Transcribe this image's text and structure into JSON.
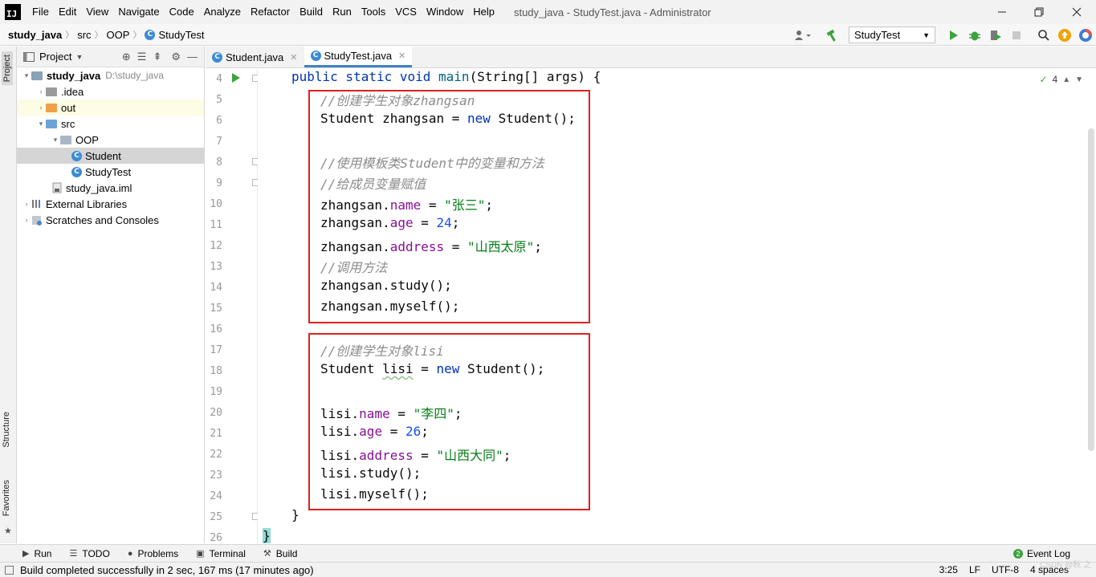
{
  "app": {
    "logo": "IJ",
    "menu": [
      "File",
      "Edit",
      "View",
      "Navigate",
      "Code",
      "Analyze",
      "Refactor",
      "Build",
      "Run",
      "Tools",
      "VCS",
      "Window",
      "Help"
    ],
    "window_title": "study_java - StudyTest.java - Administrator"
  },
  "breadcrumb": [
    "study_java",
    "src",
    "OOP",
    "StudyTest"
  ],
  "toolbar": {
    "run_config": "StudyTest"
  },
  "side_tabs": {
    "project": "Project",
    "structure": "Structure",
    "favorites": "Favorites"
  },
  "project": {
    "header": "Project",
    "tree": [
      {
        "label": "study_java",
        "extra": "D:\\study_java",
        "arrow": "▾",
        "type": "project"
      },
      {
        "label": ".idea",
        "arrow": "›",
        "type": "folder-grey"
      },
      {
        "label": "out",
        "arrow": "›",
        "type": "folder-orange"
      },
      {
        "label": "src",
        "arrow": "▾",
        "type": "folder-blue"
      },
      {
        "label": "OOP",
        "arrow": "▾",
        "type": "package"
      },
      {
        "label": "Student",
        "arrow": "",
        "type": "class"
      },
      {
        "label": "StudyTest",
        "arrow": "",
        "type": "class"
      },
      {
        "label": "study_java.iml",
        "arrow": "",
        "type": "file"
      },
      {
        "label": "External Libraries",
        "arrow": "›",
        "type": "lib"
      },
      {
        "label": "Scratches and Consoles",
        "arrow": "›",
        "type": "scratch"
      }
    ]
  },
  "editor": {
    "tabs": [
      {
        "label": "Student.java",
        "active": false
      },
      {
        "label": "StudyTest.java",
        "active": true
      }
    ],
    "line_numbers": [
      "4",
      "5",
      "6",
      "7",
      "8",
      "9",
      "10",
      "11",
      "12",
      "13",
      "14",
      "15",
      "16",
      "17",
      "18",
      "19",
      "20",
      "21",
      "22",
      "23",
      "24",
      "25",
      "26"
    ],
    "inspection_count": "4"
  },
  "code": {
    "main_sig": {
      "kw": "public static void",
      "name": "main",
      "params": "(String[] args) {"
    },
    "l5": "//创建学生对象zhangsan",
    "l6": {
      "a": "Student zhangsan = ",
      "kw": "new",
      "b": " Student();"
    },
    "l8": "//使用模板类Student中的变量和方法",
    "l9": "//给成员变量赋值",
    "l10": {
      "obj": "zhangsan.",
      "field": "name",
      "eq": " = ",
      "val": "\"张三\"",
      "end": ";"
    },
    "l11": {
      "obj": "zhangsan.",
      "field": "age",
      "eq": " = ",
      "val": "24",
      "end": ";"
    },
    "l12": {
      "obj": "zhangsan.",
      "field": "address",
      "eq": " = ",
      "val": "\"山西太原\"",
      "end": ";"
    },
    "l13": "//调用方法",
    "l14": "zhangsan.study();",
    "l15": "zhangsan.myself();",
    "l17": "//创建学生对象lisi",
    "l18": {
      "a": "Student ",
      "var": "lisi",
      "b": " = ",
      "kw": "new",
      "c": " Student();"
    },
    "l20": {
      "obj": "lisi.",
      "field": "name",
      "eq": " = ",
      "val": "\"李四\"",
      "end": ";"
    },
    "l21": {
      "obj": "lisi.",
      "field": "age",
      "eq": " = ",
      "val": "26",
      "end": ";"
    },
    "l22": {
      "obj": "lisi.",
      "field": "address",
      "eq": " = ",
      "val": "\"山西大同\"",
      "end": ";"
    },
    "l23": "lisi.study();",
    "l24": "lisi.myself();",
    "l25": "}",
    "l26": "}"
  },
  "bottom_tools": [
    "Run",
    "TODO",
    "Problems",
    "Terminal",
    "Build"
  ],
  "event_log": "Event Log",
  "event_log_count": "2",
  "status": {
    "message": "Build completed successfully in 2 sec, 167 ms (17 minutes ago)",
    "position": "3:25",
    "line_sep": "LF",
    "encoding": "UTF-8",
    "indent": "4 spaces"
  },
  "watermark": "CSDN @秋 之",
  "colors": {
    "accent": "#4083c9",
    "run_green": "#3da33d",
    "highlight_box": "#e02020"
  }
}
